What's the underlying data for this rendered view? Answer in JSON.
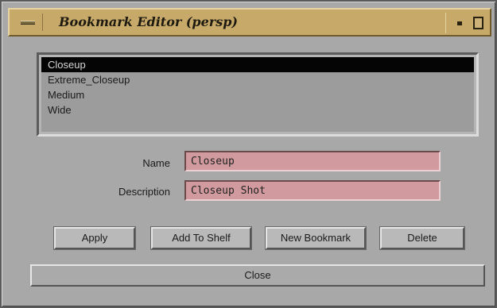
{
  "window": {
    "title": "Bookmark Editor (persp)",
    "icons": {
      "menu": "window-menu-icon",
      "minimize": "minimize-icon",
      "maximize": "maximize-icon"
    }
  },
  "bookmarks": {
    "items": [
      "Closeup",
      "Extreme_Closeup",
      "Medium",
      "Wide"
    ],
    "selected": "Closeup"
  },
  "fields": {
    "name_label": "Name",
    "name_value": "Closeup",
    "description_label": "Description",
    "description_value": "Closeup Shot"
  },
  "buttons": {
    "apply": "Apply",
    "add_to_shelf": "Add To Shelf",
    "new_bookmark": "New Bookmark",
    "delete": "Delete",
    "close": "Close"
  },
  "colors": {
    "titlebar": "#c7aa6a",
    "field_background": "#d19a9e",
    "selection": "#050505"
  }
}
